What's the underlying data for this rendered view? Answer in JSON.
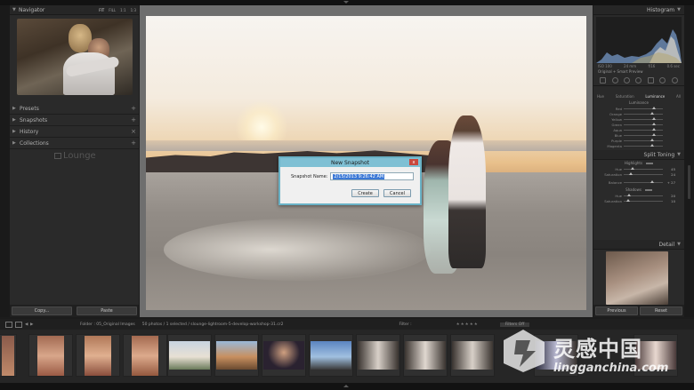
{
  "left_panel": {
    "navigator": {
      "title": "Navigator",
      "zoom_options": [
        "FIT",
        "FILL",
        "1:1",
        "1:3"
      ]
    },
    "sections": [
      {
        "label": "Presets"
      },
      {
        "label": "Snapshots"
      },
      {
        "label": "History"
      },
      {
        "label": "Collections"
      }
    ],
    "lounge_logo": "Lounge",
    "copy_label": "Copy...",
    "paste_label": "Paste"
  },
  "dialog": {
    "title": "New Snapshot",
    "field_label": "Snapshot Name:",
    "field_value": "2/15/2013 9:26:42 AM",
    "create_label": "Create",
    "cancel_label": "Cancel",
    "close_glyph": "x"
  },
  "right_panel": {
    "histogram_title": "Histogram",
    "histogram_info": [
      "ISO 100",
      "24 mm",
      "f/16",
      "0.6 sec"
    ],
    "original_preview": "Original + Smart Preview",
    "hsl_tabs": [
      "Hue",
      "Saturation",
      "Luminance",
      "All"
    ],
    "hsl_active": "Luminance",
    "luminance_head": "Luminance",
    "luminance_sliders": [
      {
        "label": "Red",
        "value": ""
      },
      {
        "label": "Orange",
        "value": ""
      },
      {
        "label": "Yellow",
        "value": ""
      },
      {
        "label": "Green",
        "value": ""
      },
      {
        "label": "Aqua",
        "value": ""
      },
      {
        "label": "Blue",
        "value": ""
      },
      {
        "label": "Purple",
        "value": ""
      },
      {
        "label": "Magenta",
        "value": ""
      }
    ],
    "split_toning_title": "Split Toning",
    "highlights_head": "Highlights",
    "highlight_sliders": [
      {
        "label": "Hue",
        "value": "45"
      },
      {
        "label": "Saturation",
        "value": "24"
      }
    ],
    "balance": {
      "label": "Balance",
      "value": "+ 27"
    },
    "shadows_head": "Shadows",
    "shadow_sliders": [
      {
        "label": "Hue",
        "value": "20"
      },
      {
        "label": "Saturation",
        "value": "10"
      }
    ],
    "detail_title": "Detail",
    "previous_label": "Previous",
    "reset_label": "Reset"
  },
  "filmstrip": {
    "info": "Folder : 05_Original Images",
    "count": "50 photos / 1 selected / slounge-lightroom-5-develop-workshop-31.cr2",
    "filter_label": "Filter :",
    "filters_off": "Filters Off",
    "pages": [
      "1",
      "2"
    ]
  },
  "watermark": {
    "cn": "灵感中国",
    "url": "lingganchina.com"
  },
  "colors": {
    "dialog_border": "#69b2c6",
    "dialog_title": "#7fc0d4",
    "close_red": "#c9473c",
    "selection_blue": "#3a78d6"
  }
}
